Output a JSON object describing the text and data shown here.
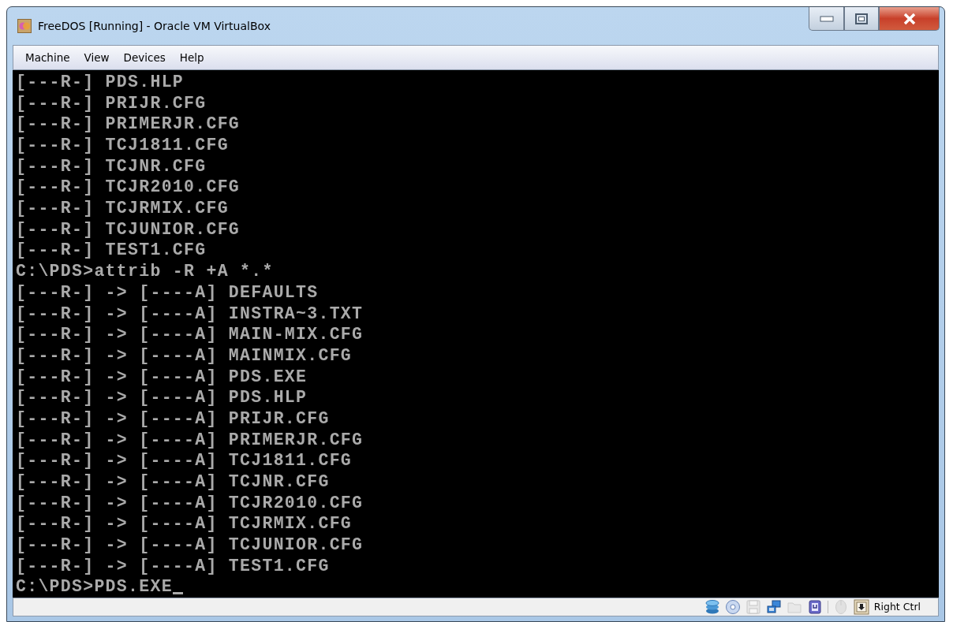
{
  "window": {
    "title": "FreeDOS [Running] - Oracle VM VirtualBox"
  },
  "menu": [
    "Machine",
    "View",
    "Devices",
    "Help"
  ],
  "terminal": {
    "lines": [
      "[---R-] PDS.HLP",
      "[---R-] PRIJR.CFG",
      "[---R-] PRIMERJR.CFG",
      "[---R-] TCJ1811.CFG",
      "[---R-] TCJNR.CFG",
      "[---R-] TCJR2010.CFG",
      "[---R-] TCJRMIX.CFG",
      "[---R-] TCJUNIOR.CFG",
      "[---R-] TEST1.CFG",
      "C:\\PDS>attrib -R +A *.*",
      "[---R-] -> [----A] DEFAULTS",
      "[---R-] -> [----A] INSTRA~3.TXT",
      "[---R-] -> [----A] MAIN-MIX.CFG",
      "[---R-] -> [----A] MAINMIX.CFG",
      "[---R-] -> [----A] PDS.EXE",
      "[---R-] -> [----A] PDS.HLP",
      "[---R-] -> [----A] PRIJR.CFG",
      "[---R-] -> [----A] PRIMERJR.CFG",
      "[---R-] -> [----A] TCJ1811.CFG",
      "[---R-] -> [----A] TCJNR.CFG",
      "[---R-] -> [----A] TCJR2010.CFG",
      "[---R-] -> [----A] TCJRMIX.CFG",
      "[---R-] -> [----A] TCJUNIOR.CFG",
      "[---R-] -> [----A] TEST1.CFG",
      "C:\\PDS>PDS.EXE"
    ],
    "cursor": true
  },
  "status_bar": {
    "indicators": [
      {
        "kind": "disk",
        "disabled": false
      },
      {
        "kind": "cd",
        "disabled": false
      },
      {
        "kind": "floppy",
        "disabled": true
      },
      {
        "kind": "network",
        "disabled": false
      },
      {
        "kind": "folder",
        "disabled": true
      },
      {
        "kind": "usb",
        "disabled": false
      },
      {
        "kind": "separator"
      },
      {
        "kind": "mouse",
        "disabled": true
      },
      {
        "kind": "hostkey",
        "disabled": false
      }
    ],
    "host_key": "Right Ctrl"
  }
}
